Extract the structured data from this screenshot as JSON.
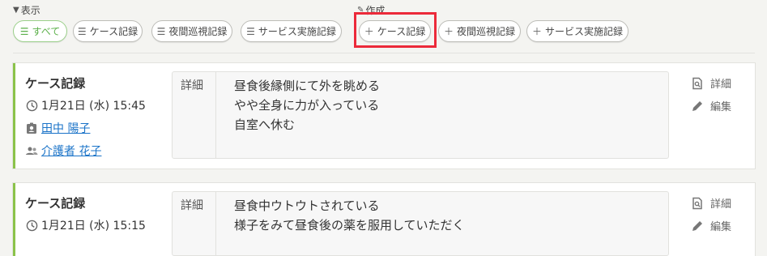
{
  "toolbar": {
    "display_label": "表示",
    "create_label": "作成",
    "filters": [
      {
        "label": "すべて",
        "active": true
      },
      {
        "label": "ケース記録",
        "active": false
      },
      {
        "label": "夜間巡視記録",
        "active": false
      },
      {
        "label": "サービス実施記録",
        "active": false
      }
    ],
    "create_buttons": [
      {
        "label": "ケース記録"
      },
      {
        "label": "夜間巡視記録"
      },
      {
        "label": "サービス実施記録"
      }
    ]
  },
  "records": [
    {
      "title": "ケース記録",
      "datetime": "1月21日 (水) 15:45",
      "resident": "田中 陽子",
      "staff": "介護者 花子",
      "detail_label": "詳細",
      "lines": [
        "昼食後縁側にて外を眺める",
        "やや全身に力が入っている",
        "自室へ休む"
      ],
      "actions": {
        "detail": "詳細",
        "edit": "編集"
      }
    },
    {
      "title": "ケース記録",
      "datetime": "1月21日 (水) 15:15",
      "detail_label": "詳細",
      "lines": [
        "昼食中ウトウトされている",
        "様子をみて昼食後の薬を服用していただく"
      ],
      "actions": {
        "detail": "詳細",
        "edit": "編集"
      }
    }
  ],
  "colors": {
    "accent_green": "#8bc34a",
    "link_blue": "#1a73c8",
    "highlight_red": "#ec2a3a"
  }
}
